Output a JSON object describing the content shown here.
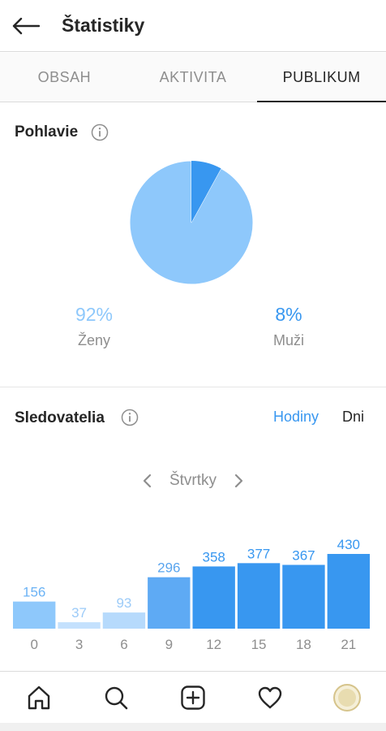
{
  "header": {
    "title": "Štatistiky"
  },
  "tabs": [
    {
      "label": "OBSAH"
    },
    {
      "label": "AKTIVITA"
    },
    {
      "label": "PUBLIKUM"
    }
  ],
  "gender": {
    "title": "Pohlavie",
    "female": {
      "percent": "92%",
      "label": "Ženy",
      "value": 92,
      "color": "#8ec8fb"
    },
    "male": {
      "percent": "8%",
      "label": "Muži",
      "value": 8,
      "color": "#3897f0"
    }
  },
  "followers": {
    "title": "Sledovatelia",
    "toggle": {
      "hours": "Hodiny",
      "days": "Dni"
    },
    "day": "Štvrtky",
    "chart_data": {
      "type": "bar",
      "categories": [
        "0",
        "3",
        "6",
        "9",
        "12",
        "15",
        "18",
        "21"
      ],
      "values": [
        156,
        37,
        93,
        296,
        358,
        377,
        367,
        430
      ],
      "bar_colors": [
        "#8ec8fb",
        "#c4e1fd",
        "#b6dafc",
        "#5eaaf4",
        "#3897f0",
        "#3897f0",
        "#3897f0",
        "#3897f0"
      ],
      "label_colors": [
        "#6cb3f5",
        "#9ccbf8",
        "#9ccbf8",
        "#5aa5ee",
        "#3897f0",
        "#3897f0",
        "#3897f0",
        "#3897f0"
      ]
    }
  },
  "icons": {
    "back": "arrow-left-icon",
    "home": "home-icon",
    "search": "search-icon",
    "add": "add-post-icon",
    "activity": "heart-icon",
    "profile": "avatar"
  }
}
